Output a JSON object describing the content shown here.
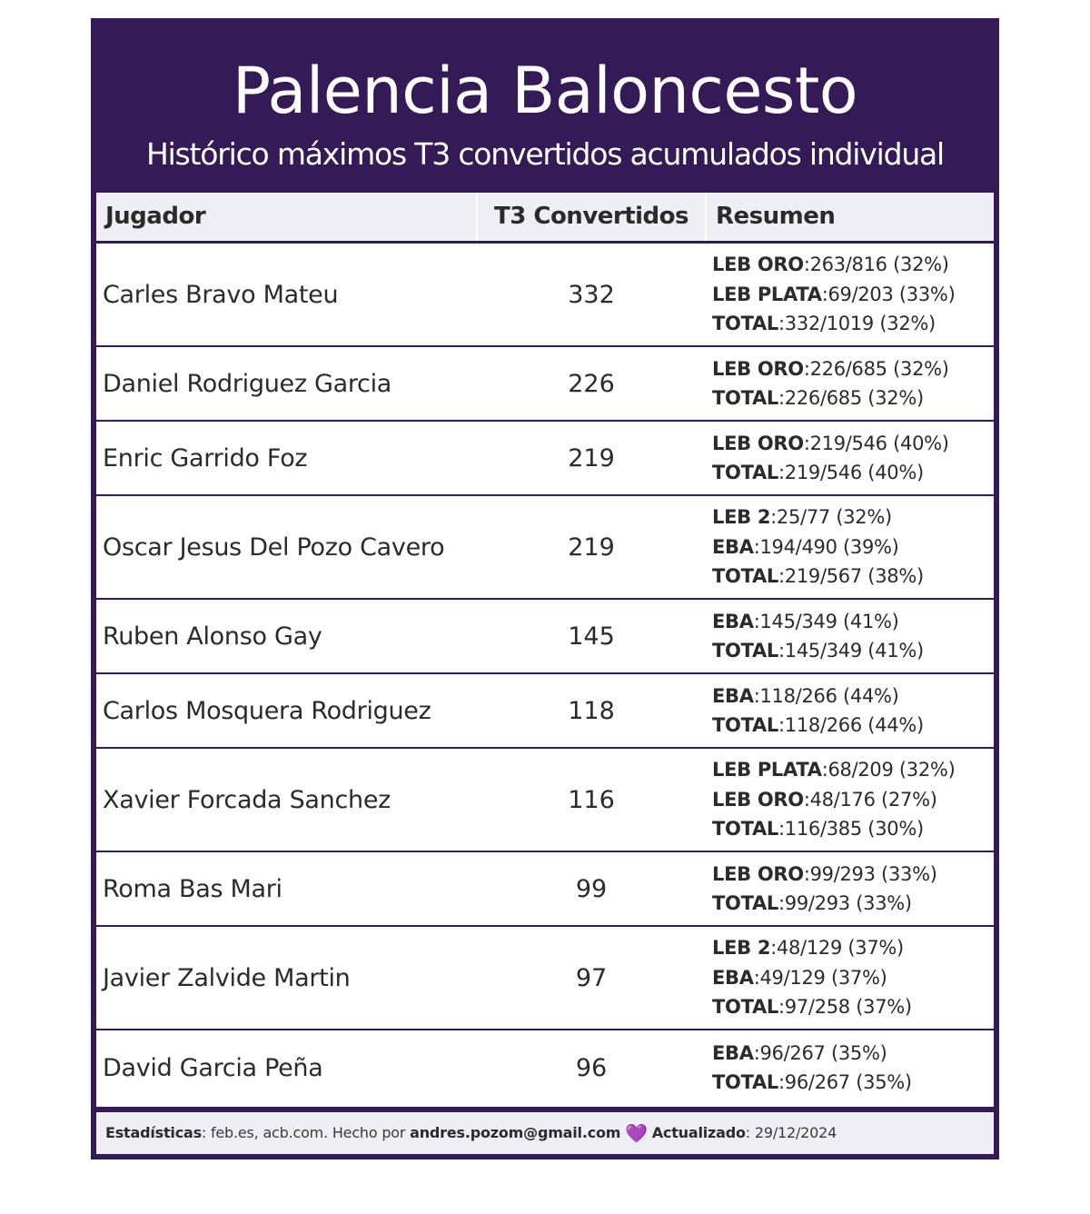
{
  "title": "Palencia Baloncesto",
  "subtitle": "Histórico máximos T3 convertidos acumulados individual",
  "columns": {
    "player": "Jugador",
    "made": "T3 Convertidos",
    "summary": "Resumen"
  },
  "rows": [
    {
      "player": "Carles Bravo Mateu",
      "made": "332",
      "summary": [
        {
          "league": "LEB ORO",
          "stat": ":263/816 (32%)"
        },
        {
          "league": "LEB PLATA",
          "stat": ":69/203 (33%)"
        },
        {
          "league": "TOTAL",
          "stat": ":332/1019 (32%)"
        }
      ]
    },
    {
      "player": "Daniel Rodriguez Garcia",
      "made": "226",
      "summary": [
        {
          "league": "LEB ORO",
          "stat": ":226/685 (32%)"
        },
        {
          "league": "TOTAL",
          "stat": ":226/685 (32%)"
        }
      ]
    },
    {
      "player": "Enric Garrido Foz",
      "made": "219",
      "summary": [
        {
          "league": "LEB ORO",
          "stat": ":219/546 (40%)"
        },
        {
          "league": "TOTAL",
          "stat": ":219/546 (40%)"
        }
      ]
    },
    {
      "player": "Oscar Jesus Del Pozo Cavero",
      "made": "219",
      "summary": [
        {
          "league": "LEB 2",
          "stat": ":25/77 (32%)"
        },
        {
          "league": "EBA",
          "stat": ":194/490 (39%)"
        },
        {
          "league": "TOTAL",
          "stat": ":219/567 (38%)"
        }
      ]
    },
    {
      "player": "Ruben Alonso Gay",
      "made": "145",
      "summary": [
        {
          "league": "EBA",
          "stat": ":145/349 (41%)"
        },
        {
          "league": "TOTAL",
          "stat": ":145/349 (41%)"
        }
      ]
    },
    {
      "player": "Carlos Mosquera Rodriguez",
      "made": "118",
      "summary": [
        {
          "league": "EBA",
          "stat": ":118/266 (44%)"
        },
        {
          "league": "TOTAL",
          "stat": ":118/266 (44%)"
        }
      ]
    },
    {
      "player": "Xavier Forcada Sanchez",
      "made": "116",
      "summary": [
        {
          "league": "LEB PLATA",
          "stat": ":68/209 (32%)"
        },
        {
          "league": "LEB ORO",
          "stat": ":48/176 (27%)"
        },
        {
          "league": "TOTAL",
          "stat": ":116/385 (30%)"
        }
      ]
    },
    {
      "player": "Roma Bas Mari",
      "made": "99",
      "summary": [
        {
          "league": "LEB ORO",
          "stat": ":99/293 (33%)"
        },
        {
          "league": "TOTAL",
          "stat": ":99/293 (33%)"
        }
      ]
    },
    {
      "player": "Javier Zalvide Martin",
      "made": "97",
      "summary": [
        {
          "league": "LEB 2",
          "stat": ":48/129 (37%)"
        },
        {
          "league": "EBA",
          "stat": ":49/129 (37%)"
        },
        {
          "league": "TOTAL",
          "stat": ":97/258 (37%)"
        }
      ]
    },
    {
      "player": "David Garcia Peña",
      "made": "96",
      "summary": [
        {
          "league": "EBA",
          "stat": ":96/267 (35%)"
        },
        {
          "league": "TOTAL",
          "stat": ":96/267 (35%)"
        }
      ]
    }
  ],
  "footer": {
    "stats_label": "Estadísticas",
    "stats_sources": ": feb.es, acb.com. Hecho por ",
    "author": "andres.pozom@gmail.com",
    "heart": "💜",
    "updated_label": "Actualizado",
    "updated_value": ": 29/12/2024"
  },
  "colors": {
    "frame": "#341b57",
    "header_bg": "#eeeef4",
    "heart": "#a44ee0"
  }
}
